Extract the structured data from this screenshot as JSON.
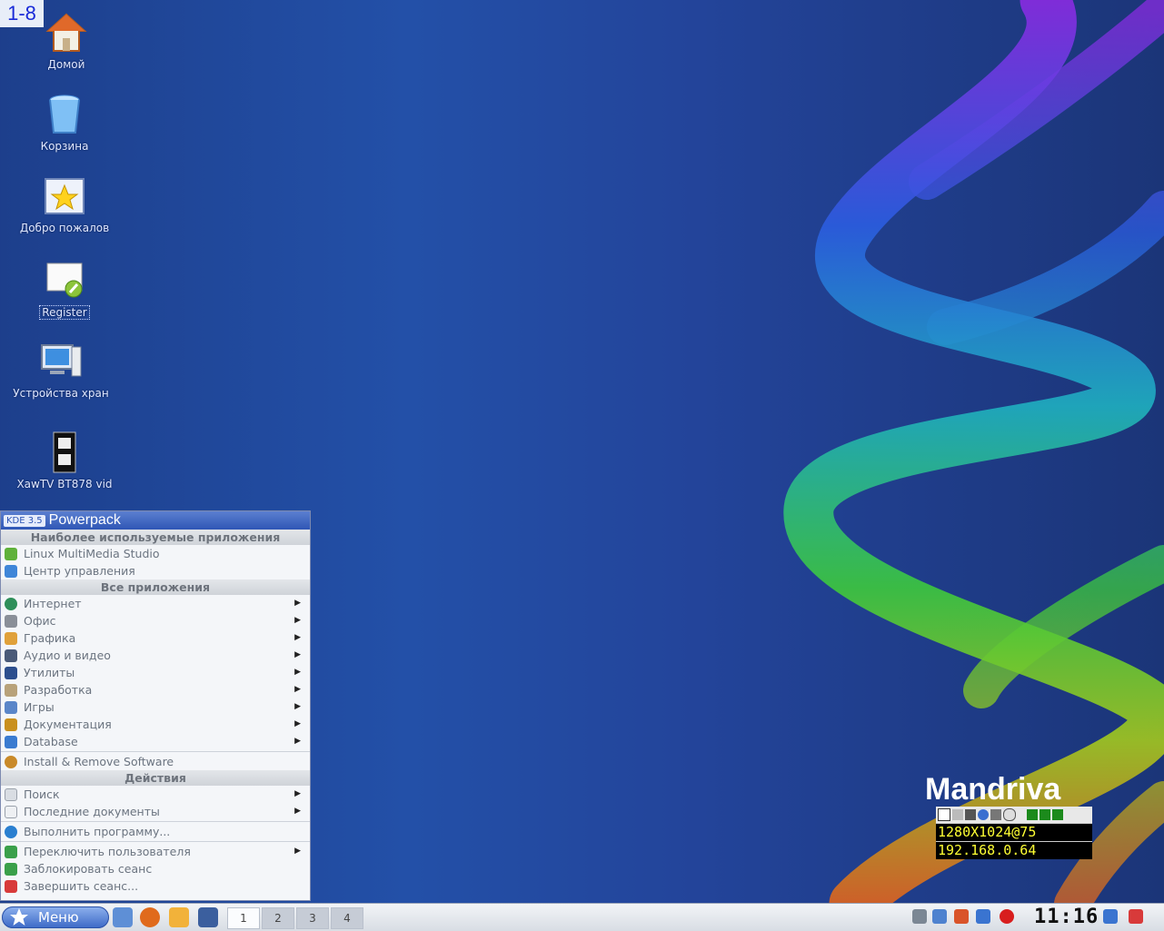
{
  "corner_label": "1-8",
  "desktop_icons": [
    {
      "label": "Домой",
      "icon": "home-icon"
    },
    {
      "label": "Корзина",
      "icon": "trash-icon"
    },
    {
      "label": "Добро пожалов",
      "icon": "welcome-star-icon"
    },
    {
      "label": "Register",
      "icon": "register-icon"
    },
    {
      "label": "Устройства хран",
      "icon": "storage-devices-icon"
    },
    {
      "label": "XawTV BT878 vid",
      "icon": "tv-film-icon"
    }
  ],
  "menu": {
    "kde_badge": "KDE 3.5",
    "brand": "Powerpack",
    "section_frequent": "Наиболее используемые приложения",
    "frequent": [
      {
        "label": "Linux MultiMedia Studio",
        "icon": "lmms-icon"
      },
      {
        "label": "Центр управления",
        "icon": "control-center-icon"
      }
    ],
    "section_all": "Все приложения",
    "categories": [
      {
        "label": "Интернет",
        "icon": "internet-globe-icon"
      },
      {
        "label": "Офис",
        "icon": "office-icon"
      },
      {
        "label": "Графика",
        "icon": "graphics-icon"
      },
      {
        "label": "Аудио и видео",
        "icon": "audio-video-icon"
      },
      {
        "label": "Утилиты",
        "icon": "utilities-icon"
      },
      {
        "label": "Разработка",
        "icon": "development-icon"
      },
      {
        "label": "Игры",
        "icon": "games-icon"
      },
      {
        "label": "Документация",
        "icon": "documentation-icon"
      },
      {
        "label": "Database",
        "icon": "database-icon"
      }
    ],
    "install_remove": "Install & Remove Software",
    "section_actions": "Действия",
    "actions_a": [
      {
        "label": "Поиск",
        "icon": "search-icon"
      },
      {
        "label": "Последние документы",
        "icon": "recent-documents-icon"
      }
    ],
    "run_program": "Выполнить программу...",
    "actions_b": [
      {
        "label": "Переключить пользователя",
        "icon": "switch-user-icon"
      },
      {
        "label": "Заблокировать сеанс",
        "icon": "lock-icon"
      },
      {
        "label": "Завершить сеанс...",
        "icon": "logout-icon"
      }
    ]
  },
  "taskbar": {
    "menu_button": "Меню",
    "desktops": [
      "1",
      "2",
      "3",
      "4"
    ],
    "clock": "11:16"
  },
  "overlay": {
    "brand": "Mandriva",
    "resolution": "1280X1024@75",
    "ip": "192.168.0.64"
  }
}
